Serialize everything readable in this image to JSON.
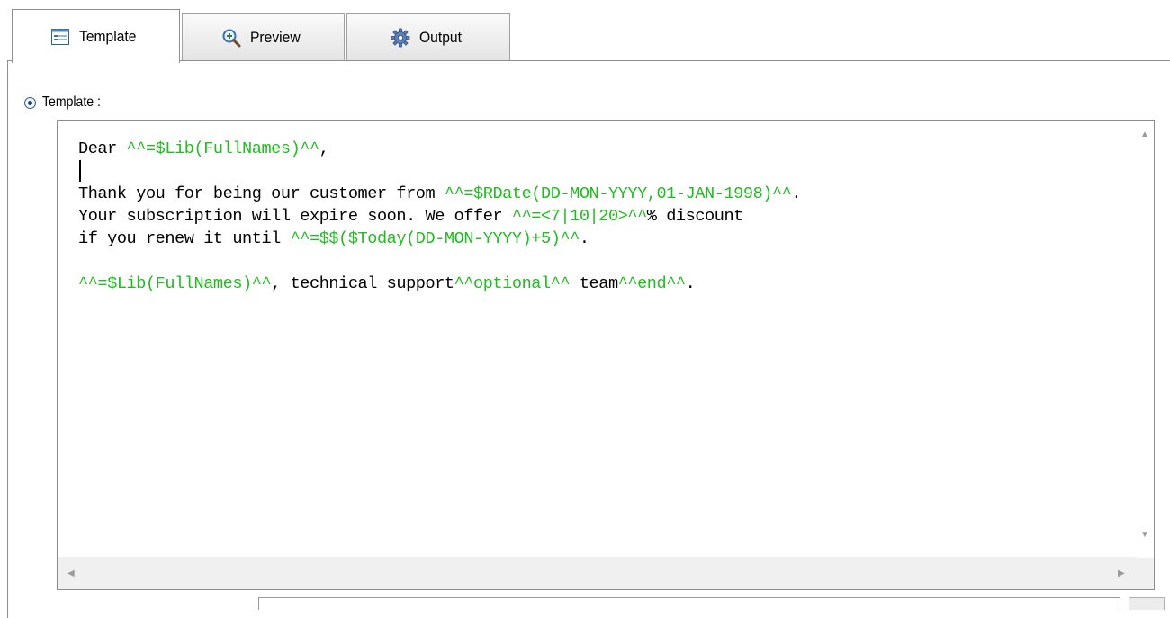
{
  "tabs": [
    {
      "label": "Template",
      "icon": "template-icon",
      "active": true
    },
    {
      "label": "Preview",
      "icon": "magnifier-icon",
      "active": false
    },
    {
      "label": "Output",
      "icon": "gear-icon",
      "active": false
    }
  ],
  "template_option": {
    "label": "Template :",
    "selected": true
  },
  "editor": {
    "tag_color": "#22bb22",
    "lines": {
      "l1": {
        "a": "Dear ",
        "b": "^^=$Lib(FullNames)^^",
        "c": ","
      },
      "l3": {
        "a": "Thank you for being our customer from ",
        "b": "^^=$RDate(DD-MON-YYYY,01-JAN-1998)^^",
        "c": "."
      },
      "l4": {
        "a": "Your subscription will expire soon. We offer ",
        "b": "^^=<7|10|20>^^",
        "c": "% discount"
      },
      "l5": {
        "a": "if you renew it until ",
        "b": "^^=$$($Today(DD-MON-YYYY)+5)^^",
        "c": "."
      },
      "l7": {
        "a": "^^=$Lib(FullNames)^^",
        "b": ", technical support",
        "c": "^^optional^^",
        "d": " team",
        "e": "^^end^^",
        "f": "."
      }
    }
  }
}
